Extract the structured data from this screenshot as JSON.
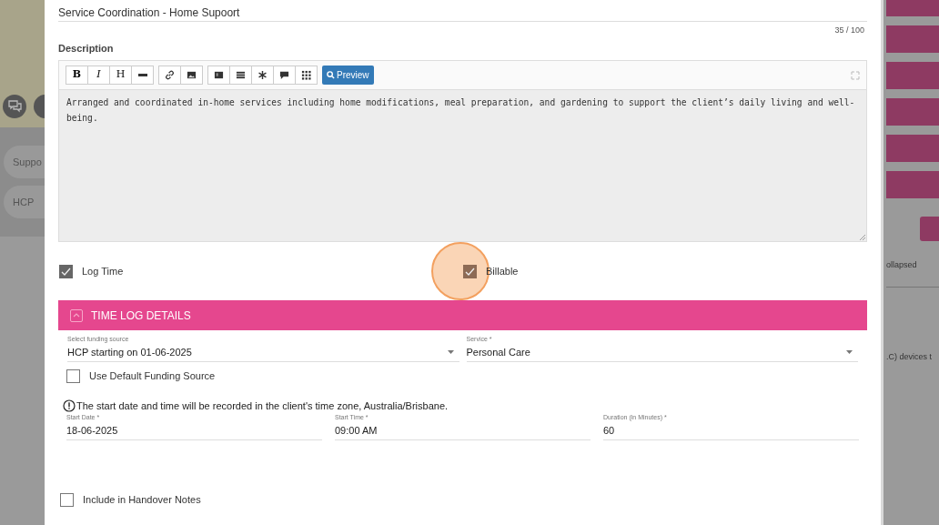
{
  "background": {
    "left_chips": [
      "Suppo",
      "HCP"
    ],
    "right_texts": [
      "ollapsed",
      ".C) devices t"
    ]
  },
  "title_field": {
    "value": "Service Coordination - Home Supoort",
    "counter": "35 / 100"
  },
  "description": {
    "label": "Description",
    "toolbar": [
      [
        {
          "kind": "text",
          "label": "B"
        },
        {
          "kind": "text",
          "label": "I"
        },
        {
          "kind": "text",
          "label": "H"
        },
        {
          "kind": "rule"
        }
      ],
      [
        {
          "kind": "link"
        },
        {
          "kind": "image"
        }
      ],
      [
        {
          "kind": "code"
        },
        {
          "kind": "list"
        },
        {
          "kind": "star"
        },
        {
          "kind": "comment"
        },
        {
          "kind": "grid"
        }
      ]
    ],
    "preview": "Preview",
    "value": "Arranged and coordinated in-home services including home modifications, meal preparation, and gardening to support the client’s daily living and well-being."
  },
  "checkboxes": [
    {
      "label": "Log Time",
      "checked": true,
      "highlighted": false
    },
    {
      "label": "Billable",
      "checked": true,
      "highlighted": true
    }
  ],
  "section": {
    "title": "TIME LOG DETAILS",
    "expanded": true
  },
  "selects": [
    {
      "label": "Select funding source",
      "value": "HCP starting on 01-06-2025"
    },
    {
      "label": "Service *",
      "value": "Personal Care"
    }
  ],
  "use_default": {
    "label": "Use Default Funding Source",
    "checked": false
  },
  "notice": "The start date and time will be recorded in the client's time zone, Australia/Brisbane.",
  "fields": [
    {
      "label": "Start Date *",
      "value": "18-06-2025"
    },
    {
      "label": "Start Time *",
      "value": "09:00 AM"
    },
    {
      "label": "Duration (in Minutes) *",
      "value": "60"
    }
  ],
  "handover": {
    "label": "Include in Handover Notes",
    "checked": false
  }
}
